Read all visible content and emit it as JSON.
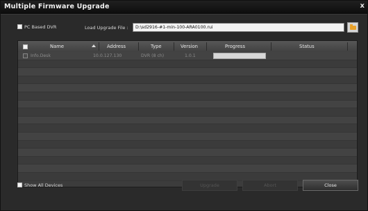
{
  "window": {
    "title": "Multiple Firmware Upgrade",
    "close": "x"
  },
  "options": {
    "pc_based_dvr": {
      "label": "PC Based DVR",
      "checked": true
    },
    "load_file_label": "Load Upgrade File :",
    "file_path": "D:\\sd2916-#1-min-100-ARA0100.rui"
  },
  "table": {
    "columns": [
      "Name",
      "Address",
      "Type",
      "Version",
      "Progress",
      "Status"
    ],
    "rows": [
      {
        "name": "Info.Desk",
        "address": "10.0.127.130",
        "type": "DVR (8 ch)",
        "version": "1.0.1",
        "progress": 0,
        "status": ""
      }
    ]
  },
  "footer": {
    "show_all": {
      "label": "Show All Devices",
      "checked": true
    },
    "upgrade": "Upgrade",
    "abort": "Abort",
    "close": "Close"
  }
}
